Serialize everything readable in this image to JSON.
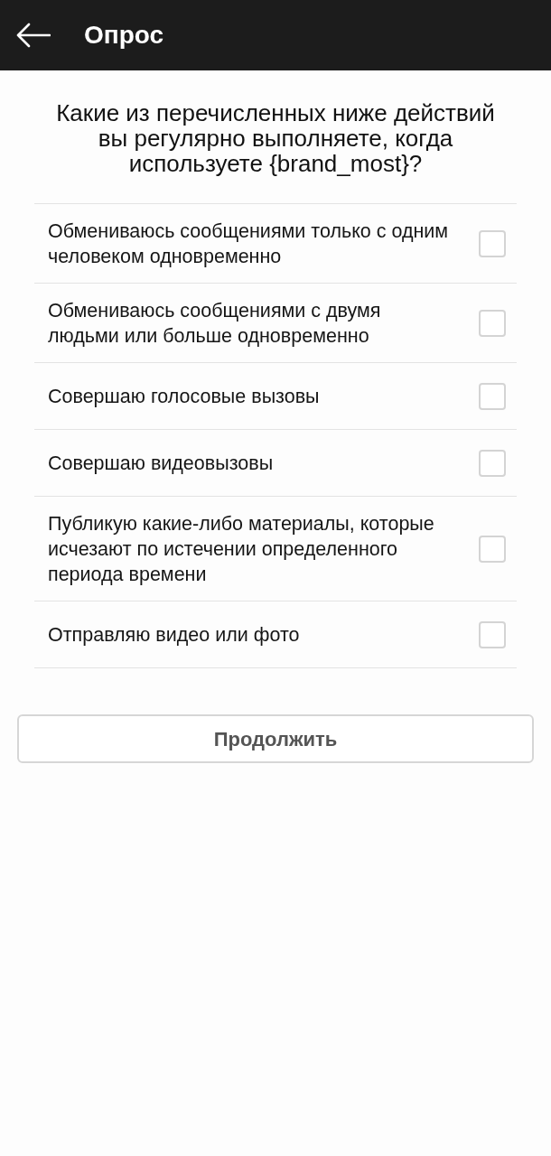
{
  "header": {
    "title": "Опрос"
  },
  "question": "Какие из перечисленных ниже действий вы регулярно выполняете, когда используете {brand_most}?",
  "options": [
    {
      "label": "Обмениваюсь сообщениями только с одним человеком одновременно",
      "checked": false
    },
    {
      "label": "Обмениваюсь сообщениями с двумя людьми или больше одновременно",
      "checked": false
    },
    {
      "label": "Совершаю голосовые вызовы",
      "checked": false
    },
    {
      "label": "Совершаю видеовызовы",
      "checked": false
    },
    {
      "label": "Публикую какие-либо материалы, которые исчезают по истечении определенного периода времени",
      "checked": false
    },
    {
      "label": "Отправляю видео или фото",
      "checked": false
    }
  ],
  "continue_button": {
    "label": "Продолжить"
  }
}
